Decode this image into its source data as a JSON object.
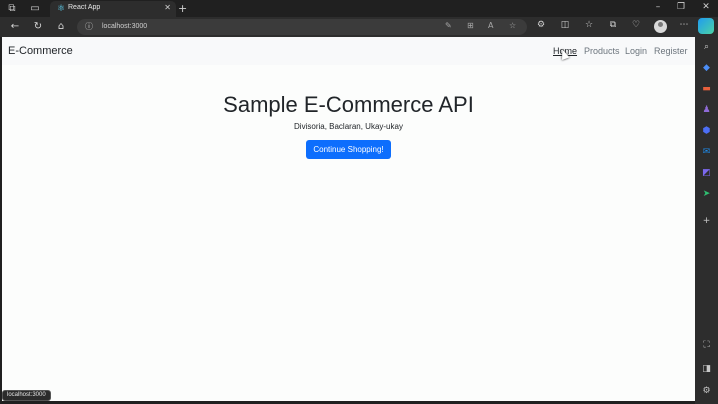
{
  "browser": {
    "tab_title": "React App",
    "url": "localhost:3000",
    "status_url": "localhost:3000",
    "icons": {
      "workspaces": "workspaces-icon",
      "tab_actions": "tab-actions-icon",
      "favicon": "react-icon",
      "close_tab": "close-icon",
      "new_tab": "plus-icon",
      "minimize": "minimize-icon",
      "restore": "restore-icon",
      "close_window": "close-icon",
      "back": "back-arrow-icon",
      "refresh": "refresh-icon",
      "home": "home-icon",
      "site_info": "info-icon",
      "read_aloud": "read-aloud-icon",
      "favorite": "star-icon",
      "more": "more-icon"
    },
    "glyphs": {
      "workspaces": "⧉",
      "tab_actions": "▭",
      "favicon": "⚛",
      "close": "✕",
      "plus": "+",
      "minimize": "–",
      "restore": "❐",
      "back": "←",
      "refresh": "↻",
      "home": "⌂",
      "info": "ⓘ",
      "pen": "✎",
      "app": "⊞",
      "read": "A",
      "star": "☆",
      "extensions": "⚙",
      "split": "◫",
      "favorites": "☆",
      "collections": "⧉",
      "performance": "♡",
      "more": "⋯"
    }
  },
  "navbar": {
    "brand": "E-Commerce",
    "links": [
      {
        "label": "Home",
        "active": true
      },
      {
        "label": "Products",
        "active": false
      },
      {
        "label": "Login",
        "active": false
      },
      {
        "label": "Register",
        "active": false
      }
    ]
  },
  "hero": {
    "title": "Sample E-Commerce API",
    "subtitle": "Divisoria, Baclaran, Ukay-ukay",
    "button_label": "Continue Shopping!"
  },
  "sidebar": {
    "icons": [
      {
        "name": "search-icon",
        "glyph": "⌕",
        "color": "#c9c9c9"
      },
      {
        "name": "shopping-tag-icon",
        "glyph": "◆",
        "color": "#4c8ef7"
      },
      {
        "name": "toolbox-icon",
        "glyph": "▬",
        "color": "#e8603c"
      },
      {
        "name": "games-icon",
        "glyph": "♟",
        "color": "#8f6bd8"
      },
      {
        "name": "security-icon",
        "glyph": "⬢",
        "color": "#4c6ef5"
      },
      {
        "name": "outlook-icon",
        "glyph": "✉",
        "color": "#1e88e5"
      },
      {
        "name": "designer-icon",
        "glyph": "◩",
        "color": "#7b68ee"
      },
      {
        "name": "send-icon",
        "glyph": "➤",
        "color": "#2fbf71"
      },
      {
        "name": "add-icon",
        "glyph": "+",
        "color": "#c9c9c9"
      }
    ],
    "bottom_icons": [
      {
        "name": "screenshot-icon",
        "glyph": "⛶",
        "color": "#c9c9c9"
      },
      {
        "name": "sidebar-toggle-icon",
        "glyph": "◨",
        "color": "#c9c9c9"
      },
      {
        "name": "settings-icon",
        "glyph": "⚙",
        "color": "#c9c9c9"
      }
    ]
  },
  "colors": {
    "primary_button": "#0d6efd",
    "navbar_bg": "#f8f9fa",
    "page_bg": "#fcfdfc",
    "browser_chrome": "#2d2d2d"
  }
}
